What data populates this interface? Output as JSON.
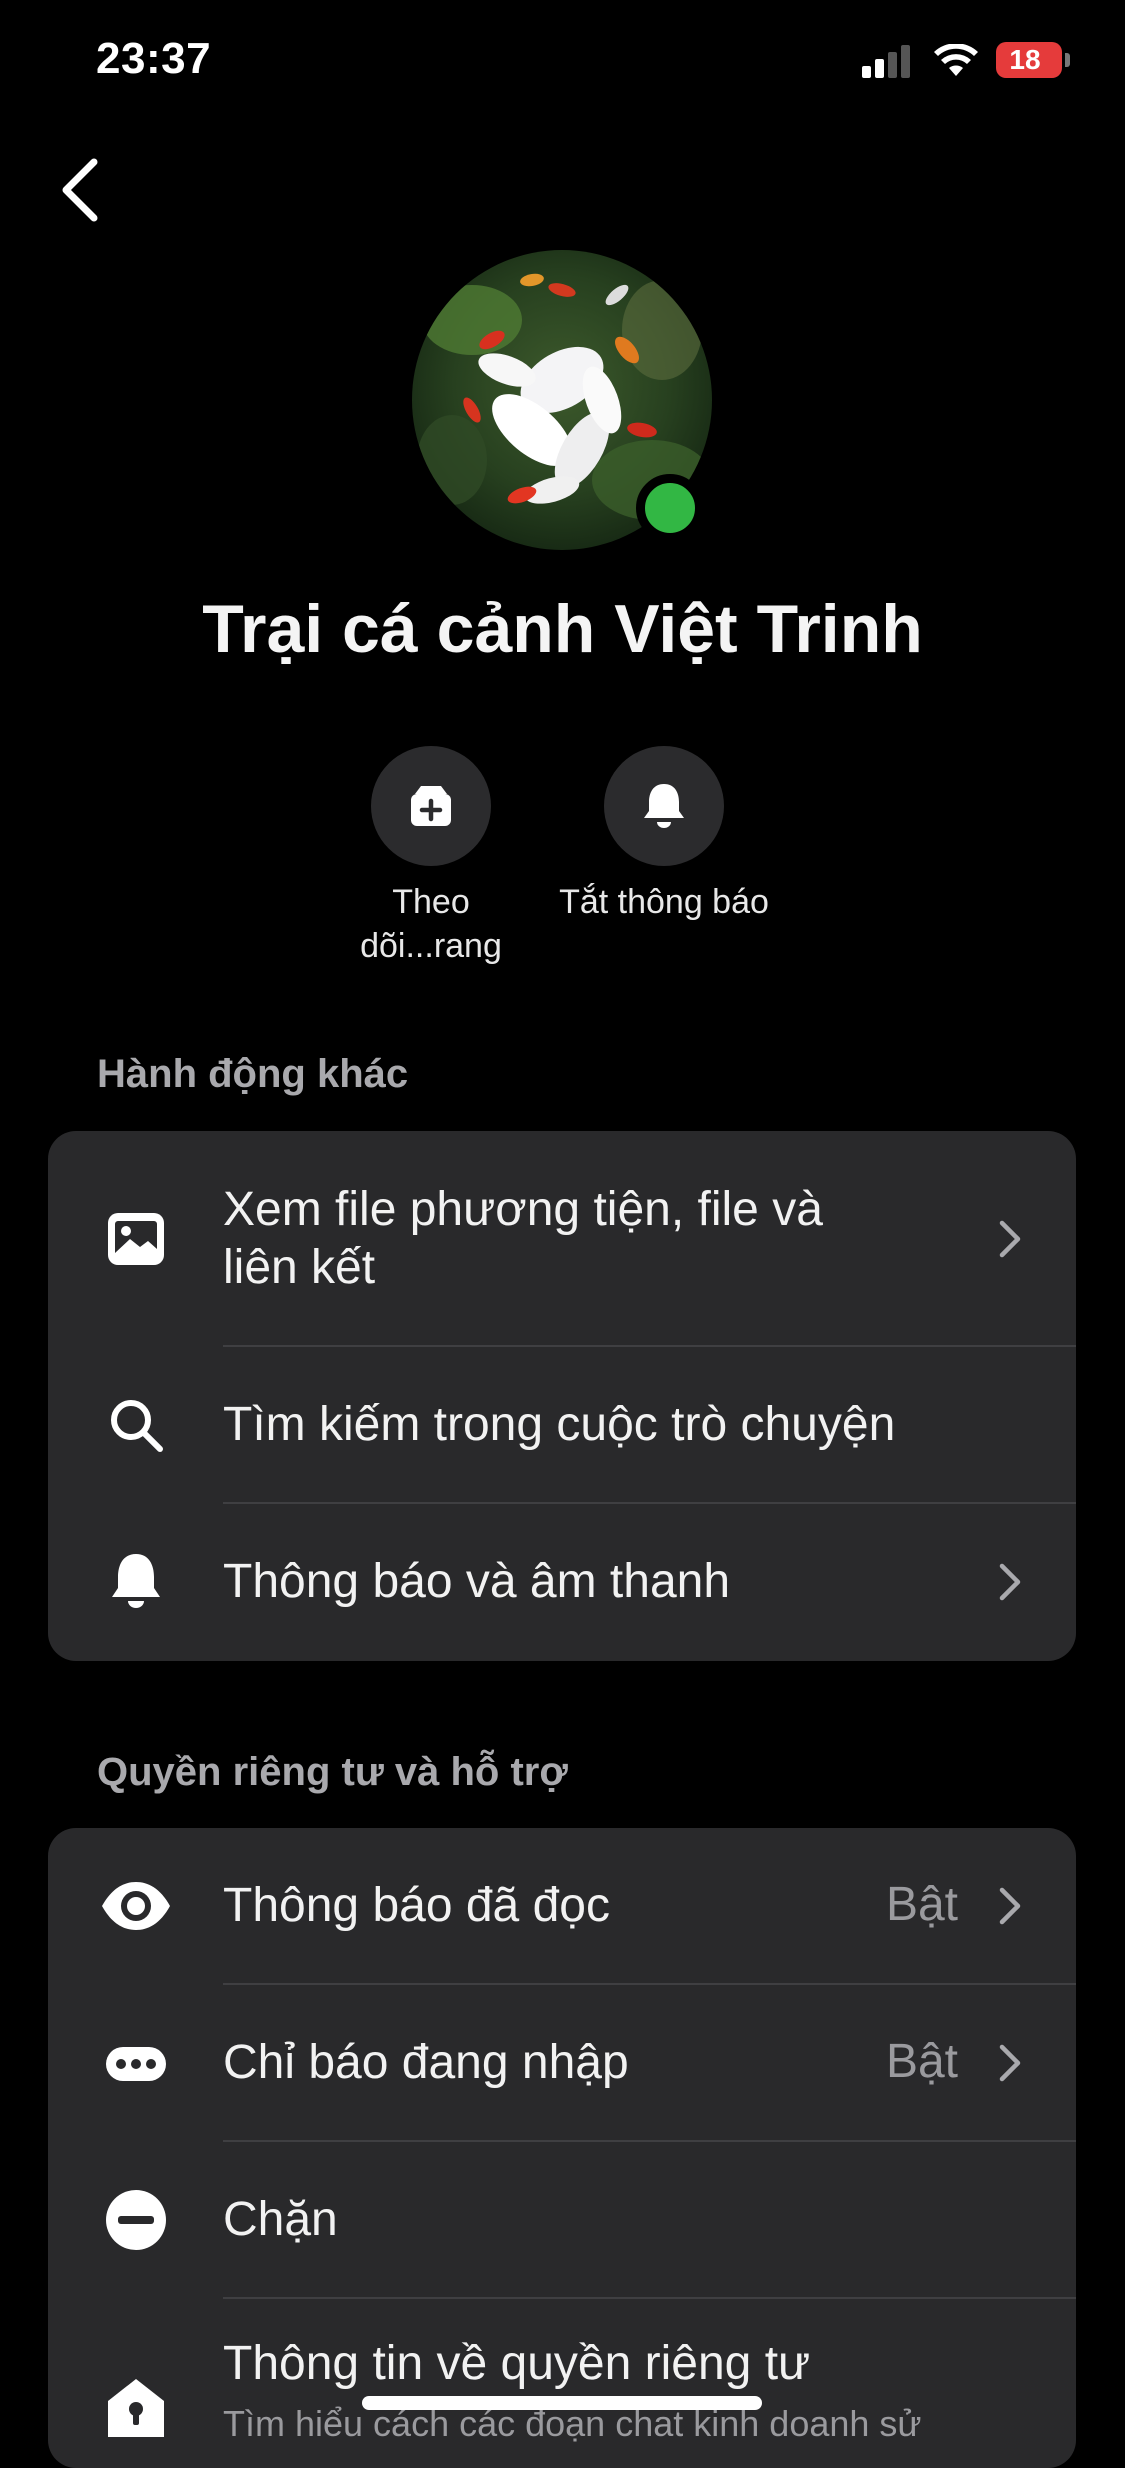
{
  "status_bar": {
    "time": "23:37",
    "battery": "18"
  },
  "profile": {
    "name": "Trại cá cảnh Việt Trinh",
    "online": true,
    "online_color": "#32b744"
  },
  "quick_actions": [
    {
      "icon": "follow-page-icon",
      "label_line1": "Theo",
      "label_line2": "dõi...rang"
    },
    {
      "icon": "bell-icon",
      "label_line1": "Tắt thông báo"
    }
  ],
  "section_more_actions": {
    "title": "Hành động khác",
    "items": [
      {
        "icon": "image-icon",
        "label_line1": "Xem file phương tiện, file và",
        "label_line2": "liên kết",
        "chevron": true
      },
      {
        "icon": "search-icon",
        "label": "Tìm kiếm trong cuộc trò chuyện",
        "chevron": false
      },
      {
        "icon": "bell-icon",
        "label": "Thông báo và âm thanh",
        "chevron": true
      }
    ]
  },
  "section_privacy": {
    "title": "Quyền riêng tư và hỗ trợ",
    "items": [
      {
        "icon": "eye-icon",
        "label": "Thông báo đã đọc",
        "value": "Bật",
        "chevron": true
      },
      {
        "icon": "typing-indicator-icon",
        "label": "Chỉ báo đang nhập",
        "value": "Bật",
        "chevron": true
      },
      {
        "icon": "block-icon",
        "label": "Chặn",
        "chevron": false
      },
      {
        "icon": "privacy-house-icon",
        "label": "Thông tin về quyền riêng tư",
        "sub": "Tìm hiểu cách các đoạn chat kinh doanh sử"
      }
    ]
  }
}
